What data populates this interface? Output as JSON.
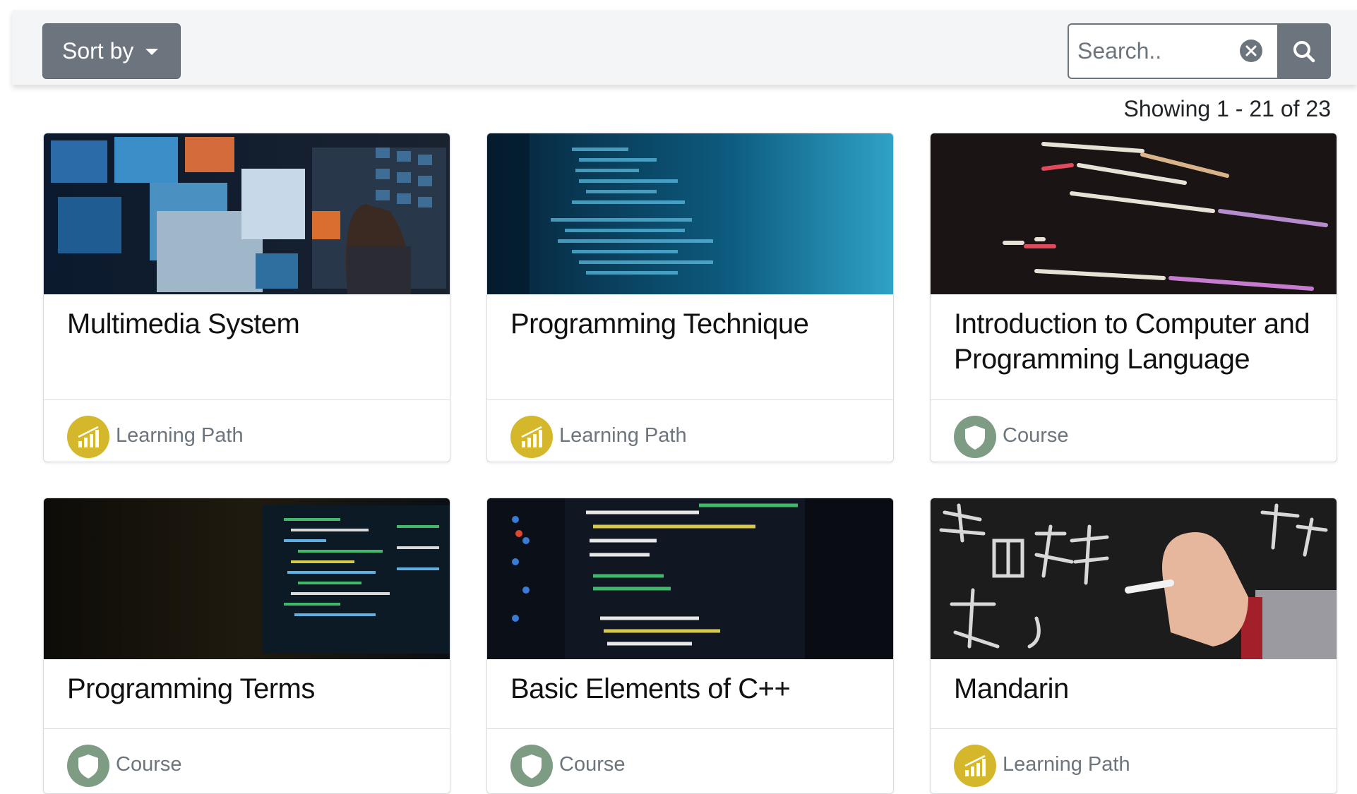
{
  "toolbar": {
    "sort_label": "Sort by",
    "search_placeholder": "Search.."
  },
  "results": {
    "showing": "Showing 1 - 21 of 23"
  },
  "colors": {
    "learning_path": "#d4b72a",
    "course": "#7e9c84"
  },
  "cards": [
    {
      "title": "Multimedia System",
      "type": "Learning Path",
      "badge_icon": "bar-chart-icon"
    },
    {
      "title": "Programming Technique",
      "type": "Learning Path",
      "badge_icon": "bar-chart-icon"
    },
    {
      "title": "Introduction to Computer and Programming Language",
      "type": "Course",
      "badge_icon": "shield-icon"
    },
    {
      "title": "Programming Terms",
      "type": "Course",
      "badge_icon": "shield-icon"
    },
    {
      "title": "Basic Elements of C++",
      "type": "Course",
      "badge_icon": "shield-icon"
    },
    {
      "title": "Mandarin",
      "type": "Learning Path",
      "badge_icon": "bar-chart-icon"
    }
  ]
}
